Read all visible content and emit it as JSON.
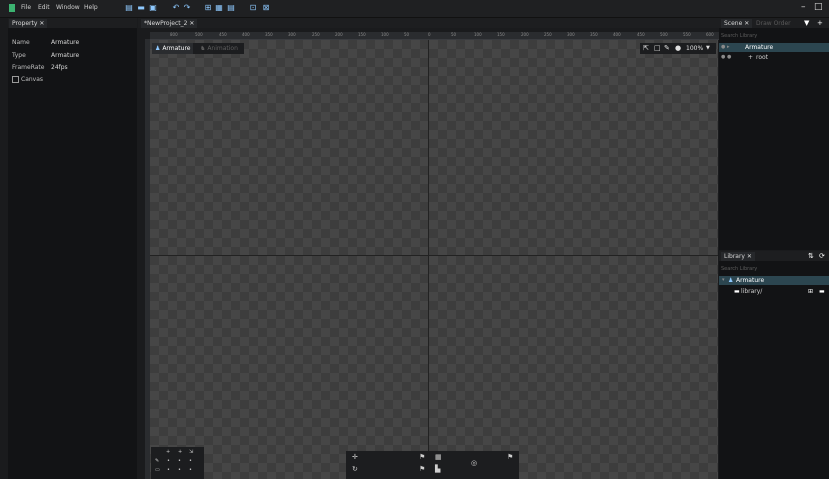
{
  "menubar": {
    "items": [
      "File",
      "Edit",
      "Window",
      "Help"
    ],
    "toolbar_icons": [
      "new-project-icon",
      "open-folder-icon",
      "save-icon",
      "undo-icon",
      "redo-icon",
      "import-icon",
      "export-icon",
      "export-all-icon",
      "publish-icon",
      "settings-icon"
    ],
    "window_controls": [
      "minimize-icon",
      "maximize-icon"
    ]
  },
  "left_panel": {
    "tab_label": "Property",
    "properties": [
      {
        "label": "Name",
        "value": "Armature"
      },
      {
        "label": "Type",
        "value": "Armature"
      },
      {
        "label": "FrameRate",
        "value": "24fps"
      }
    ],
    "canvas_checkbox_label": "Canvas"
  },
  "center": {
    "tab_label": "*NewProject_2",
    "mode_tabs": [
      "Armature",
      "Animation"
    ],
    "zoom": "100%",
    "ruler_top": [
      "800",
      "500",
      "450",
      "400",
      "350",
      "300",
      "250",
      "200",
      "150",
      "100",
      "50",
      "0",
      "50",
      "100",
      "150",
      "200",
      "250",
      "300",
      "350",
      "400",
      "450",
      "500",
      "550",
      "600"
    ]
  },
  "scene_panel": {
    "tab_label": "Scene",
    "tab_label_inactive": "Draw Order",
    "search_placeholder": "Search Library",
    "tree": [
      {
        "label": "Armature"
      },
      {
        "label": "root"
      }
    ]
  },
  "library_panel": {
    "tab_label": "Library",
    "search_placeholder": "Search Library",
    "tree": [
      {
        "label": "Armature"
      },
      {
        "label": "library/"
      }
    ]
  },
  "colors": {
    "accent": "#8ec9ff",
    "selected_row": "#2c4650"
  }
}
